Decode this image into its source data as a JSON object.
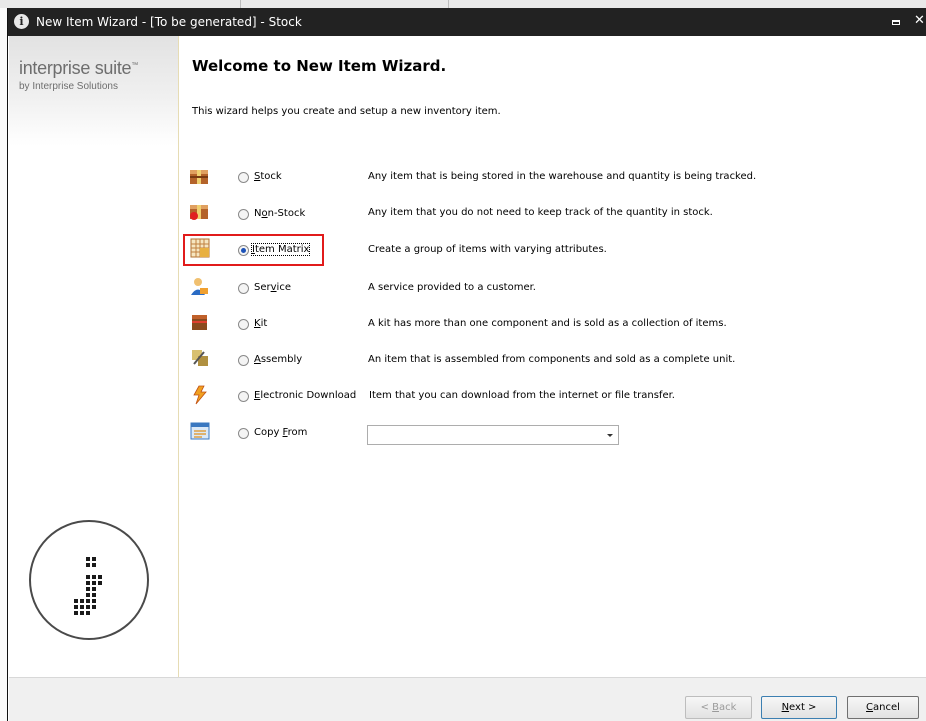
{
  "window": {
    "title": "New Item Wizard - [To be generated] - Stock"
  },
  "sidebar": {
    "brand": "interprise suite",
    "brand_mark": "™",
    "brand_sub": "by Interprise Solutions"
  },
  "main": {
    "heading": "Welcome to New Item Wizard.",
    "intro": "This wizard helps you create and setup a new inventory item."
  },
  "options": [
    {
      "key": "stock",
      "pre": "",
      "accel": "S",
      "post": "tock",
      "description": "Any item that is being stored in the warehouse and quantity is being tracked.",
      "checked": false,
      "icon": "stock-box-icon"
    },
    {
      "key": "non-stock",
      "pre": "N",
      "accel": "o",
      "post": "n-Stock",
      "description": "Any item that you do not need to keep track of the quantity in stock.",
      "checked": false,
      "icon": "non-stock-box-icon"
    },
    {
      "key": "item-matrix",
      "pre": "",
      "accel": "I",
      "post": "tem Matrix",
      "description": "Create a group of items with varying attributes.",
      "checked": true,
      "icon": "item-matrix-grid-icon"
    },
    {
      "key": "service",
      "pre": "Ser",
      "accel": "v",
      "post": "ice",
      "description": "A service provided to a customer.",
      "checked": false,
      "icon": "service-person-icon"
    },
    {
      "key": "kit",
      "pre": "",
      "accel": "K",
      "post": "it",
      "description": "A kit has more than one component and is sold as a collection of items.",
      "checked": false,
      "icon": "kit-chest-icon"
    },
    {
      "key": "assembly",
      "pre": "",
      "accel": "A",
      "post": "ssembly",
      "description": "An item that is assembled from components and sold as a complete unit.",
      "checked": false,
      "icon": "assembly-icon"
    },
    {
      "key": "electronic-download",
      "pre": "",
      "accel": "E",
      "post": "lectronic Download",
      "description": "Item that you can download from the internet or file transfer.",
      "checked": false,
      "icon": "download-bolt-icon"
    },
    {
      "key": "copy-from",
      "pre": "Copy ",
      "accel": "F",
      "post": "rom",
      "description": "",
      "checked": false,
      "icon": "copy-window-icon"
    }
  ],
  "copy_from": {
    "value": ""
  },
  "buttons": {
    "back": {
      "label": "< ",
      "accel": "B",
      "post": "ack",
      "enabled": false
    },
    "next": {
      "label": "",
      "accel": "N",
      "post": "ext >",
      "enabled": true
    },
    "cancel": {
      "label": "",
      "accel": "C",
      "post": "ancel",
      "enabled": true
    }
  },
  "colors": {
    "titlebar": "#222222",
    "highlight": "#e11b1b",
    "radio_selected": "#1c52b8",
    "sidebar_border": "#e6dcb4"
  }
}
